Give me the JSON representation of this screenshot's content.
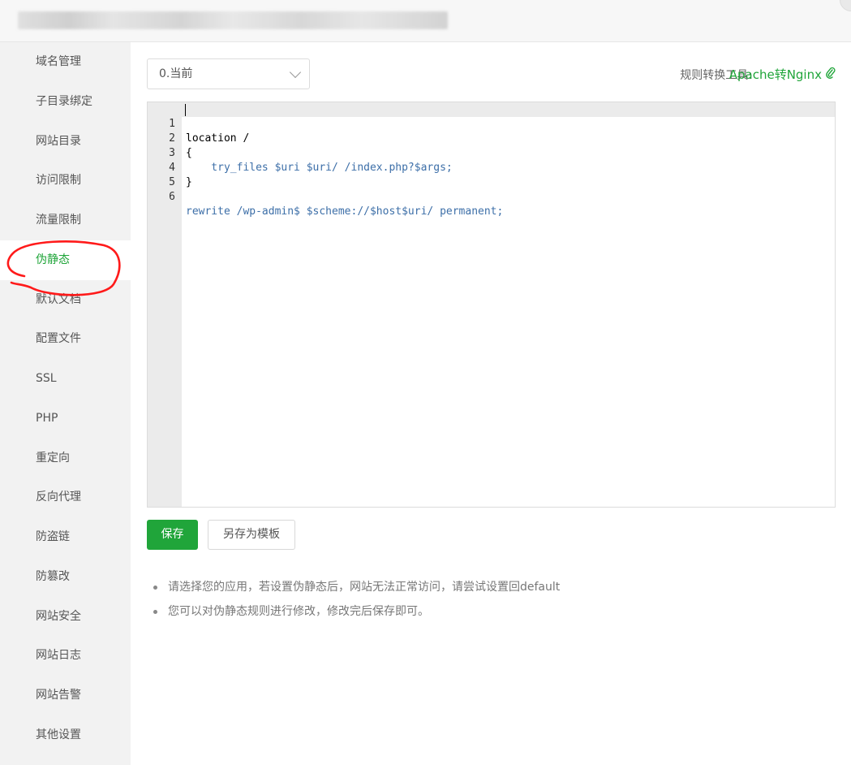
{
  "sidebar": {
    "items": [
      {
        "label": "域名管理"
      },
      {
        "label": "子目录绑定"
      },
      {
        "label": "网站目录"
      },
      {
        "label": "访问限制"
      },
      {
        "label": "流量限制"
      },
      {
        "label": "伪静态",
        "active": true
      },
      {
        "label": "默认文档"
      },
      {
        "label": "配置文件"
      },
      {
        "label": "SSL"
      },
      {
        "label": "PHP"
      },
      {
        "label": "重定向"
      },
      {
        "label": "反向代理"
      },
      {
        "label": "防盗链"
      },
      {
        "label": "防篡改"
      },
      {
        "label": "网站安全"
      },
      {
        "label": "网站日志"
      },
      {
        "label": "网站告警"
      },
      {
        "label": "其他设置"
      }
    ]
  },
  "toolbar": {
    "template_select": "0.当前",
    "tool_label": "规则转换工具:",
    "tool_link": "Apache转Nginx",
    "link_icon": "paperclip-icon"
  },
  "editor": {
    "lines": [
      {
        "num": "1",
        "text": "location /"
      },
      {
        "num": "2",
        "text": "{"
      },
      {
        "num": "3",
        "text": "    try_files $uri $uri/ /index.php?$args;"
      },
      {
        "num": "4",
        "text": "}"
      },
      {
        "num": "5",
        "text": ""
      },
      {
        "num": "6",
        "text": "rewrite /wp-admin$ $scheme://$host$uri/ permanent;"
      }
    ]
  },
  "actions": {
    "save_label": "保存",
    "save_template_label": "另存为模板"
  },
  "tips": [
    "请选择您的应用，若设置伪静态后，网站无法正常访问，请尝试设置回default",
    "您可以对伪静态规则进行修改，修改完后保存即可。"
  ],
  "colors": {
    "accent": "#20a53a",
    "sidebar_bg": "#f2f2f2",
    "annotation": "#ff1a1a"
  }
}
